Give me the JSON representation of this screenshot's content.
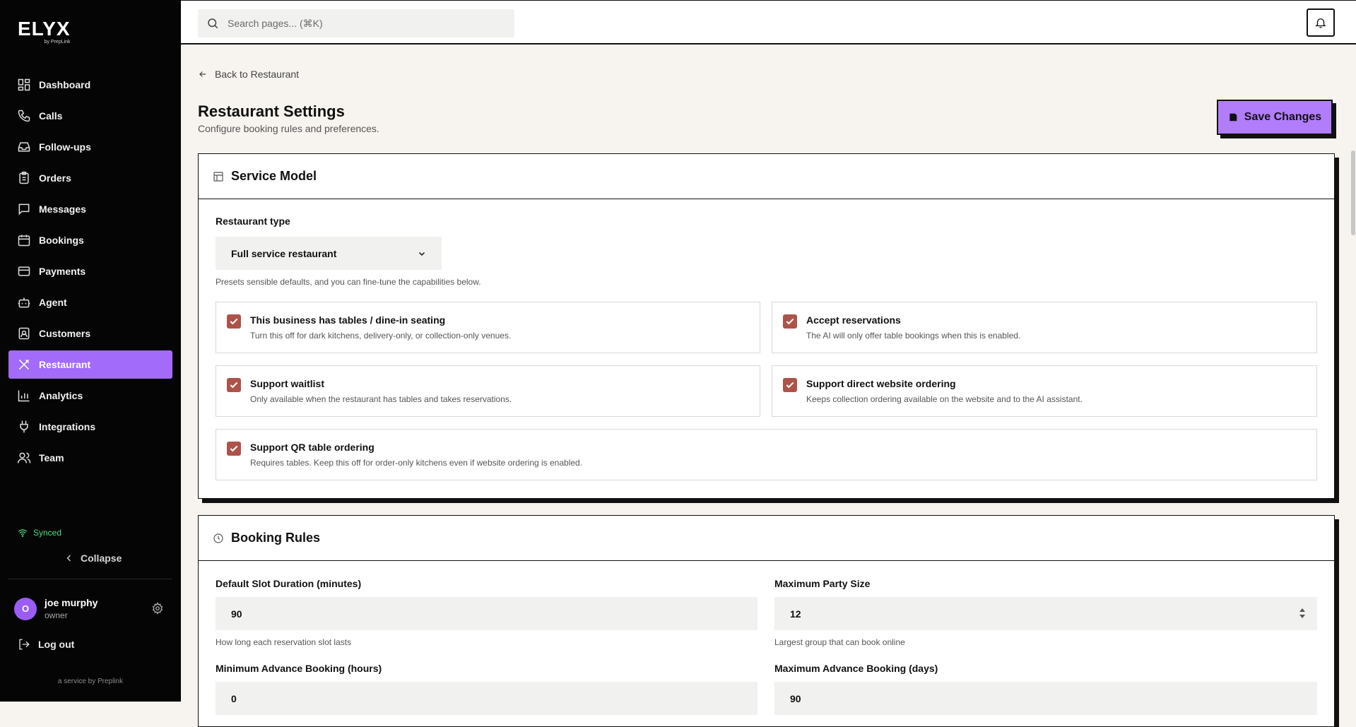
{
  "brand": {
    "logo": "ELYX",
    "by": "by PrepLink"
  },
  "search": {
    "placeholder": "Search pages... (⌘K)"
  },
  "sidebar": {
    "items": [
      {
        "label": "Dashboard",
        "icon": "dashboard-icon"
      },
      {
        "label": "Calls",
        "icon": "phone-icon"
      },
      {
        "label": "Follow-ups",
        "icon": "inbox-icon"
      },
      {
        "label": "Orders",
        "icon": "clipboard-icon"
      },
      {
        "label": "Messages",
        "icon": "message-icon"
      },
      {
        "label": "Bookings",
        "icon": "calendar-icon"
      },
      {
        "label": "Payments",
        "icon": "credit-card-icon"
      },
      {
        "label": "Agent",
        "icon": "robot-icon"
      },
      {
        "label": "Customers",
        "icon": "contact-icon"
      },
      {
        "label": "Restaurant",
        "icon": "utensils-icon",
        "active": true
      },
      {
        "label": "Analytics",
        "icon": "bar-chart-icon"
      },
      {
        "label": "Integrations",
        "icon": "plug-icon"
      },
      {
        "label": "Team",
        "icon": "users-icon"
      }
    ],
    "status": "Synced",
    "collapse": "Collapse",
    "user": {
      "initial": "O",
      "name": "joe murphy",
      "role": "owner"
    },
    "logout": "Log out",
    "footer": "a service by Preplink"
  },
  "page": {
    "back": "Back to Restaurant",
    "title": "Restaurant Settings",
    "subtitle": "Configure booking rules and preferences.",
    "save": "Save Changes"
  },
  "service_model": {
    "title": "Service Model",
    "type_label": "Restaurant type",
    "type_value": "Full service restaurant",
    "type_help": "Presets sensible defaults, and you can fine-tune the capabilities below.",
    "options": [
      {
        "title": "This business has tables / dine-in seating",
        "desc": "Turn this off for dark kitchens, delivery-only, or collection-only venues.",
        "checked": true
      },
      {
        "title": "Accept reservations",
        "desc": "The AI will only offer table bookings when this is enabled.",
        "checked": true
      },
      {
        "title": "Support waitlist",
        "desc": "Only available when the restaurant has tables and takes reservations.",
        "checked": true
      },
      {
        "title": "Support direct website ordering",
        "desc": "Keeps collection ordering available on the website and to the AI assistant.",
        "checked": true
      },
      {
        "title": "Support QR table ordering",
        "desc": "Requires tables. Keep this off for order-only kitchens even if website ordering is enabled.",
        "checked": true
      }
    ]
  },
  "booking_rules": {
    "title": "Booking Rules",
    "fields": [
      {
        "label": "Default Slot Duration (minutes)",
        "value": "90",
        "help": "How long each reservation slot lasts"
      },
      {
        "label": "Maximum Party Size",
        "value": "12",
        "help": "Largest group that can book online"
      },
      {
        "label": "Minimum Advance Booking (hours)",
        "value": "0"
      },
      {
        "label": "Maximum Advance Booking (days)",
        "value": "90"
      }
    ]
  },
  "colors": {
    "accent": "#a26bfa",
    "checkbox": "#ad5349",
    "synced": "#4ade80"
  }
}
